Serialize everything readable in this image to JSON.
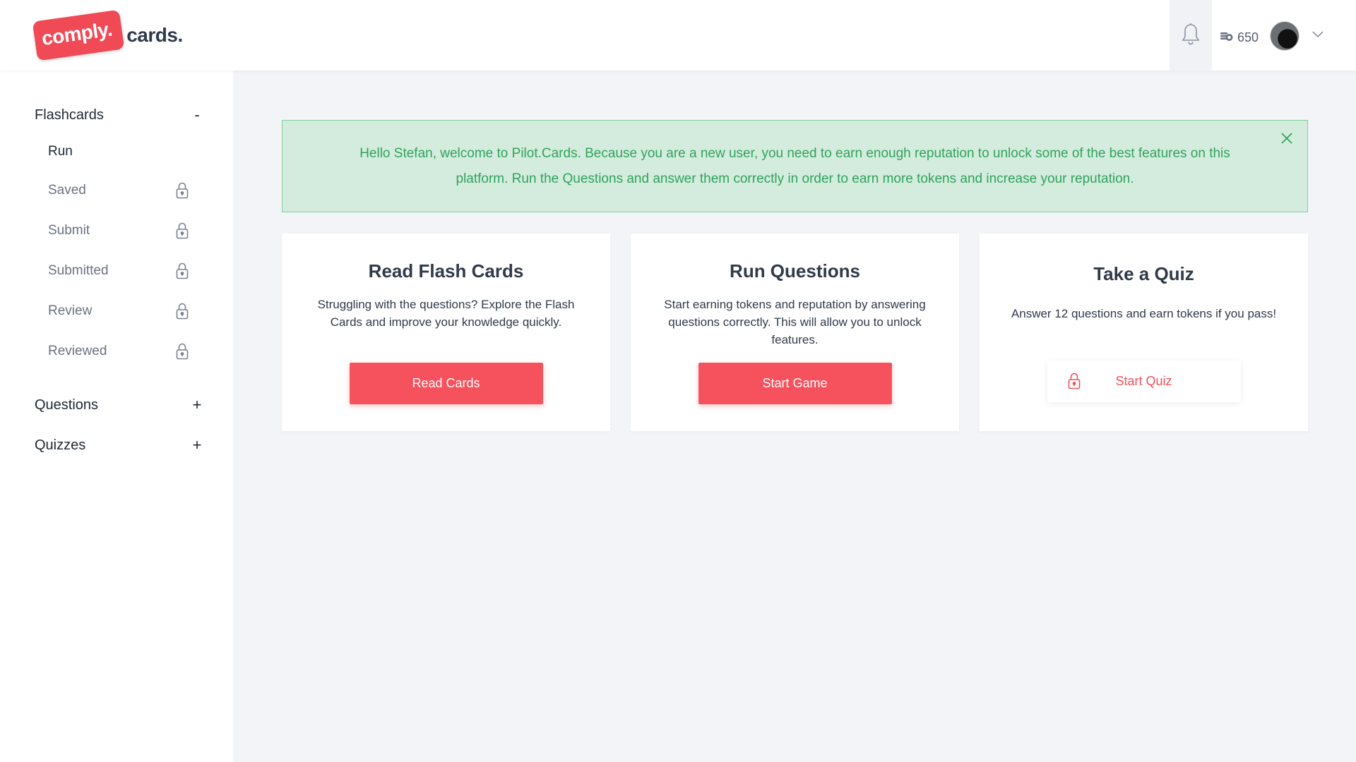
{
  "brand": {
    "badge_text": "comply.",
    "suffix_text": "cards.",
    "accent_color": "#ef4a56"
  },
  "header": {
    "notification_icon": "bell-icon",
    "tokens_icon": "coins-icon",
    "tokens_value": "650",
    "avatar_icon": "user-avatar",
    "menu_icon": "chevron-down-icon"
  },
  "sidebar": {
    "sections": [
      {
        "label": "Flashcards",
        "toggle": "-",
        "items": [
          {
            "label": "Run",
            "locked": false
          },
          {
            "label": "Saved",
            "locked": true
          },
          {
            "label": "Submit",
            "locked": true
          },
          {
            "label": "Submitted",
            "locked": true
          },
          {
            "label": "Review",
            "locked": true
          },
          {
            "label": "Reviewed",
            "locked": true
          }
        ]
      },
      {
        "label": "Questions",
        "toggle": "+"
      },
      {
        "label": "Quizzes",
        "toggle": "+"
      }
    ]
  },
  "alert": {
    "message": "Hello Stefan, welcome to Pilot.Cards. Because you are a new user, you need to earn enough reputation to unlock some of the best features on this platform. Run the Questions and answer them correctly in order to earn more tokens and increase your reputation.",
    "close_icon": "close-icon",
    "color": "#2fa35b"
  },
  "cards": [
    {
      "title": "Read Flash Cards",
      "description": "Struggling with the questions? Explore the Flash Cards and improve your knowledge quickly.",
      "button": "Read Cards",
      "locked": false
    },
    {
      "title": "Run Questions",
      "description": "Start earning tokens and reputation by answering questions correctly. This will allow you to unlock features.",
      "button": "Start Game",
      "locked": false
    },
    {
      "title": "Take a Quiz",
      "description": "Answer 12 questions and earn tokens if you pass!",
      "button": "Start Quiz",
      "locked": true
    }
  ]
}
